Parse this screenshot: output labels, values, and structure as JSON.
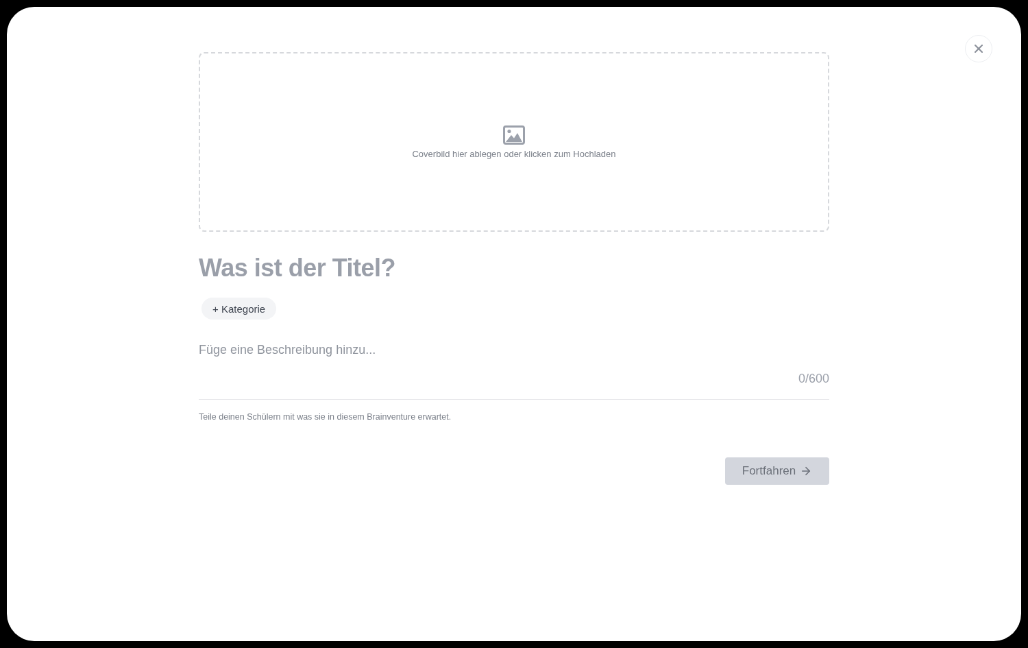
{
  "cover_upload": {
    "hint": "Coverbild hier ablegen oder klicken zum Hochladen"
  },
  "title_field": {
    "placeholder": "Was ist der Titel?"
  },
  "category_button": {
    "label": "+ Kategorie"
  },
  "description_field": {
    "placeholder": "Füge eine Beschreibung hinzu...",
    "counter": "0/600",
    "helper": "Teile deinen Schülern mit was sie in diesem Brainventure erwartet."
  },
  "continue_button": {
    "label": "Fortfahren",
    "disabled": true
  }
}
